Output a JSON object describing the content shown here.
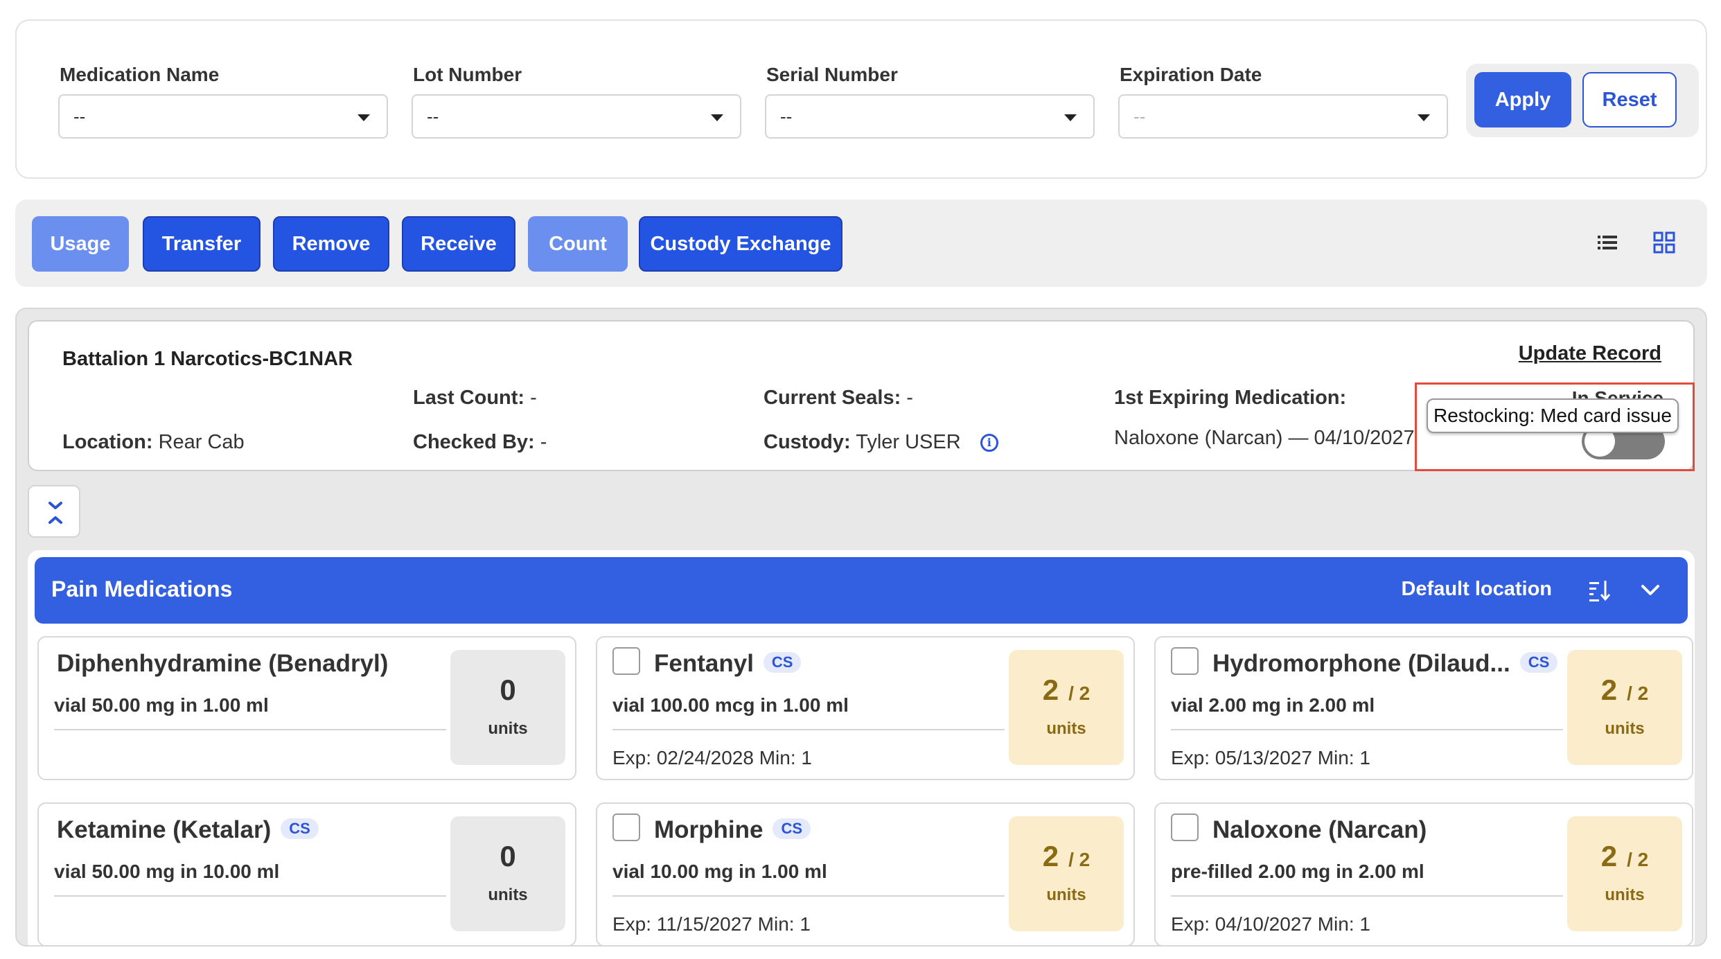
{
  "filters": [
    {
      "label": "Medication Name",
      "value": "--",
      "disabled": false
    },
    {
      "label": "Lot Number",
      "value": "--",
      "disabled": false
    },
    {
      "label": "Serial Number",
      "value": "--",
      "disabled": false
    },
    {
      "label": "Expiration Date",
      "value": "--",
      "disabled": true
    }
  ],
  "filter_buttons": {
    "apply": "Apply",
    "reset": "Reset"
  },
  "actions": [
    {
      "label": "Usage",
      "enabled": false
    },
    {
      "label": "Transfer",
      "enabled": true
    },
    {
      "label": "Remove",
      "enabled": true
    },
    {
      "label": "Receive",
      "enabled": true
    },
    {
      "label": "Count",
      "enabled": false
    },
    {
      "label": "Custody Exchange",
      "enabled": true
    }
  ],
  "view_toggle": {
    "list_icon": "list-view-icon",
    "grid_icon": "grid-view-icon"
  },
  "record": {
    "title": "Battalion 1 Narcotics-BC1NAR",
    "update_link": "Update Record",
    "location_label": "Location:",
    "location_value": "Rear Cab",
    "last_count_label": "Last Count:",
    "last_count_value": "-",
    "checked_by_label": "Checked By:",
    "checked_by_value": "-",
    "current_seals_label": "Current Seals:",
    "current_seals_value": "-",
    "custody_label": "Custody:",
    "custody_value": "Tyler USER",
    "first_expiring_label": "1st Expiring Medication:",
    "first_expiring_value": "Naloxone (Narcan) — 04/10/2027",
    "status_label": "In Service",
    "status_on": false,
    "tooltip": "Restocking: Med card issue"
  },
  "section": {
    "title": "Pain Medications",
    "location": "Default location"
  },
  "medications": [
    {
      "name": "Diphenhydramine (Benadryl)",
      "cs": false,
      "checkbox": false,
      "desc": "vial 50.00 mg in 1.00 ml",
      "exp": "",
      "qty": "0",
      "par": "",
      "units": "units"
    },
    {
      "name": "Fentanyl",
      "cs": true,
      "checkbox": true,
      "desc": "vial 100.00 mcg in 1.00 ml",
      "exp": "Exp: 02/24/2028  Min: 1",
      "qty": "2",
      "par": "/ 2",
      "units": "units"
    },
    {
      "name": "Hydromorphone (Dilaud...",
      "cs": true,
      "checkbox": true,
      "desc": "vial 2.00 mg in 2.00 ml",
      "exp": "Exp: 05/13/2027  Min: 1",
      "qty": "2",
      "par": "/ 2",
      "units": "units"
    },
    {
      "name": "Ketamine (Ketalar)",
      "cs": true,
      "checkbox": false,
      "desc": "vial 50.00 mg in 10.00 ml",
      "exp": "",
      "qty": "0",
      "par": "",
      "units": "units"
    },
    {
      "name": "Morphine",
      "cs": true,
      "checkbox": true,
      "desc": "vial 10.00 mg in 1.00 ml",
      "exp": "Exp: 11/15/2027  Min: 1",
      "qty": "2",
      "par": "/ 2",
      "units": "units"
    },
    {
      "name": "Naloxone (Narcan)",
      "cs": false,
      "checkbox": true,
      "desc": "pre-filled 2.00 mg in 2.00 ml",
      "exp": "Exp: 04/10/2027  Min: 1",
      "qty": "2",
      "par": "/ 2",
      "units": "units"
    }
  ],
  "cs_badge": "CS",
  "colors": {
    "primary": "#3360e0",
    "primary_light": "#6b8fee",
    "alert_border": "#e24a3b",
    "qty_ok_bg": "#fbeccb",
    "qty_zero_bg": "#e9e9e9"
  }
}
